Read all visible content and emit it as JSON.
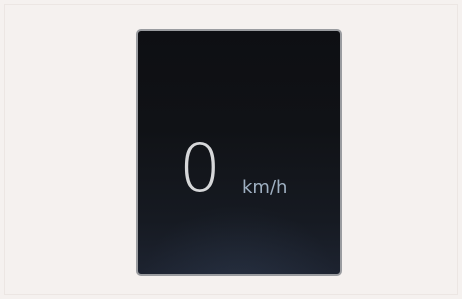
{
  "speedometer": {
    "value": "0",
    "unit": "km/h"
  },
  "colors": {
    "background": "#f5f1ef",
    "panel": "#0f1115",
    "panel_border": "#9a9ca0",
    "value_text": "#d6d7d9",
    "unit_text": "#9fb0c2"
  }
}
